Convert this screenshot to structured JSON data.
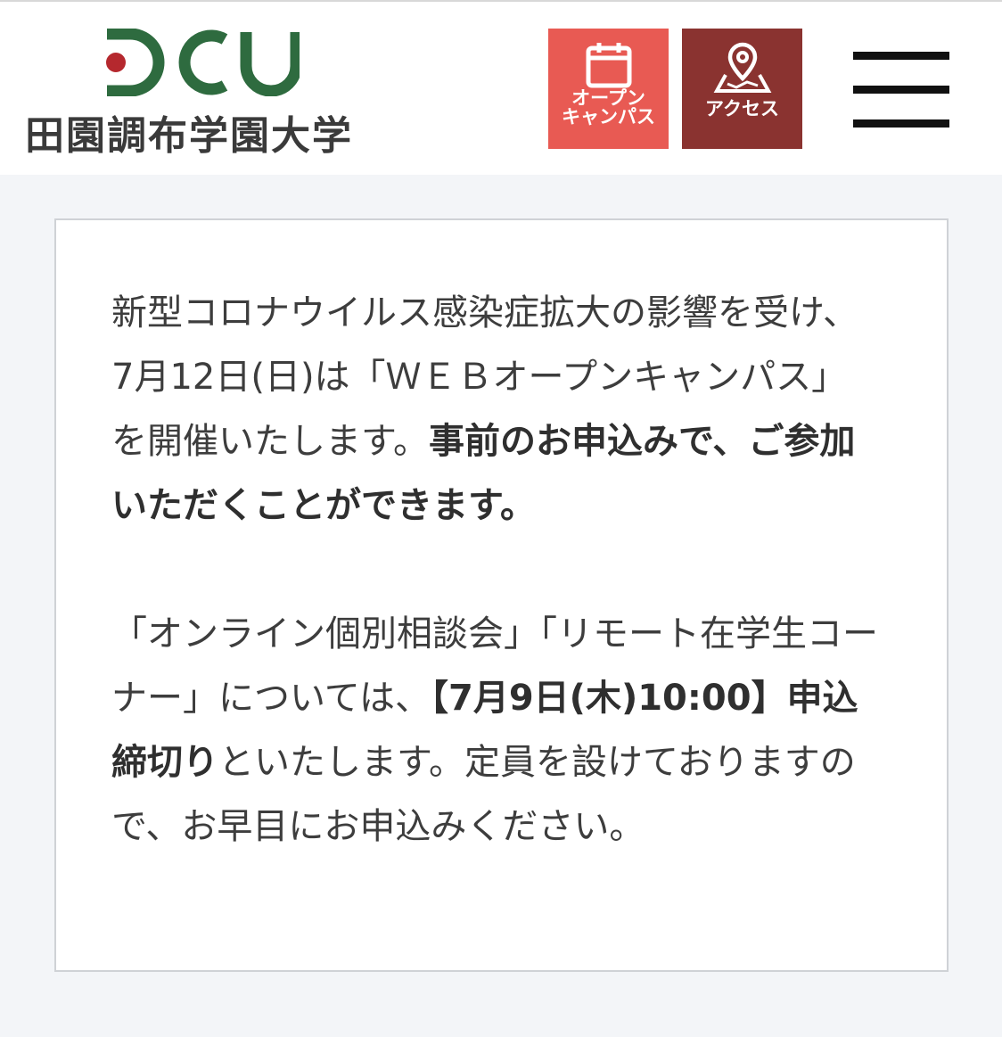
{
  "header": {
    "logo_mark": "DCU",
    "logo_text": "田園調布学園大学",
    "open_campus_label_line1": "オープン",
    "open_campus_label_line2": "キャンパス",
    "access_label": "アクセス",
    "colors": {
      "open_campus_bg": "#e85a53",
      "access_bg": "#8a3330",
      "logo_green": "#2e6b3f",
      "logo_red": "#b5282e"
    },
    "icons": [
      "calendar-icon",
      "map-pin-icon",
      "menu-icon"
    ]
  },
  "notice": {
    "p1_text1": "新型コロナウイルス感染症拡大の影響を受け、7月12日(日)は「ＷＥＢオープンキャンパス」を開催いたします。",
    "p1_bold1": "事前のお申込みで、ご参加いただくことができます。",
    "p2_text1": "「オンライン個別相談会」「リモート在学生コーナー」については、",
    "p2_bold1": "【7月9日(木)10:00】申込締切り",
    "p2_text2": "といたします。定員を設けておりますので、お早目にお申込みください。"
  }
}
